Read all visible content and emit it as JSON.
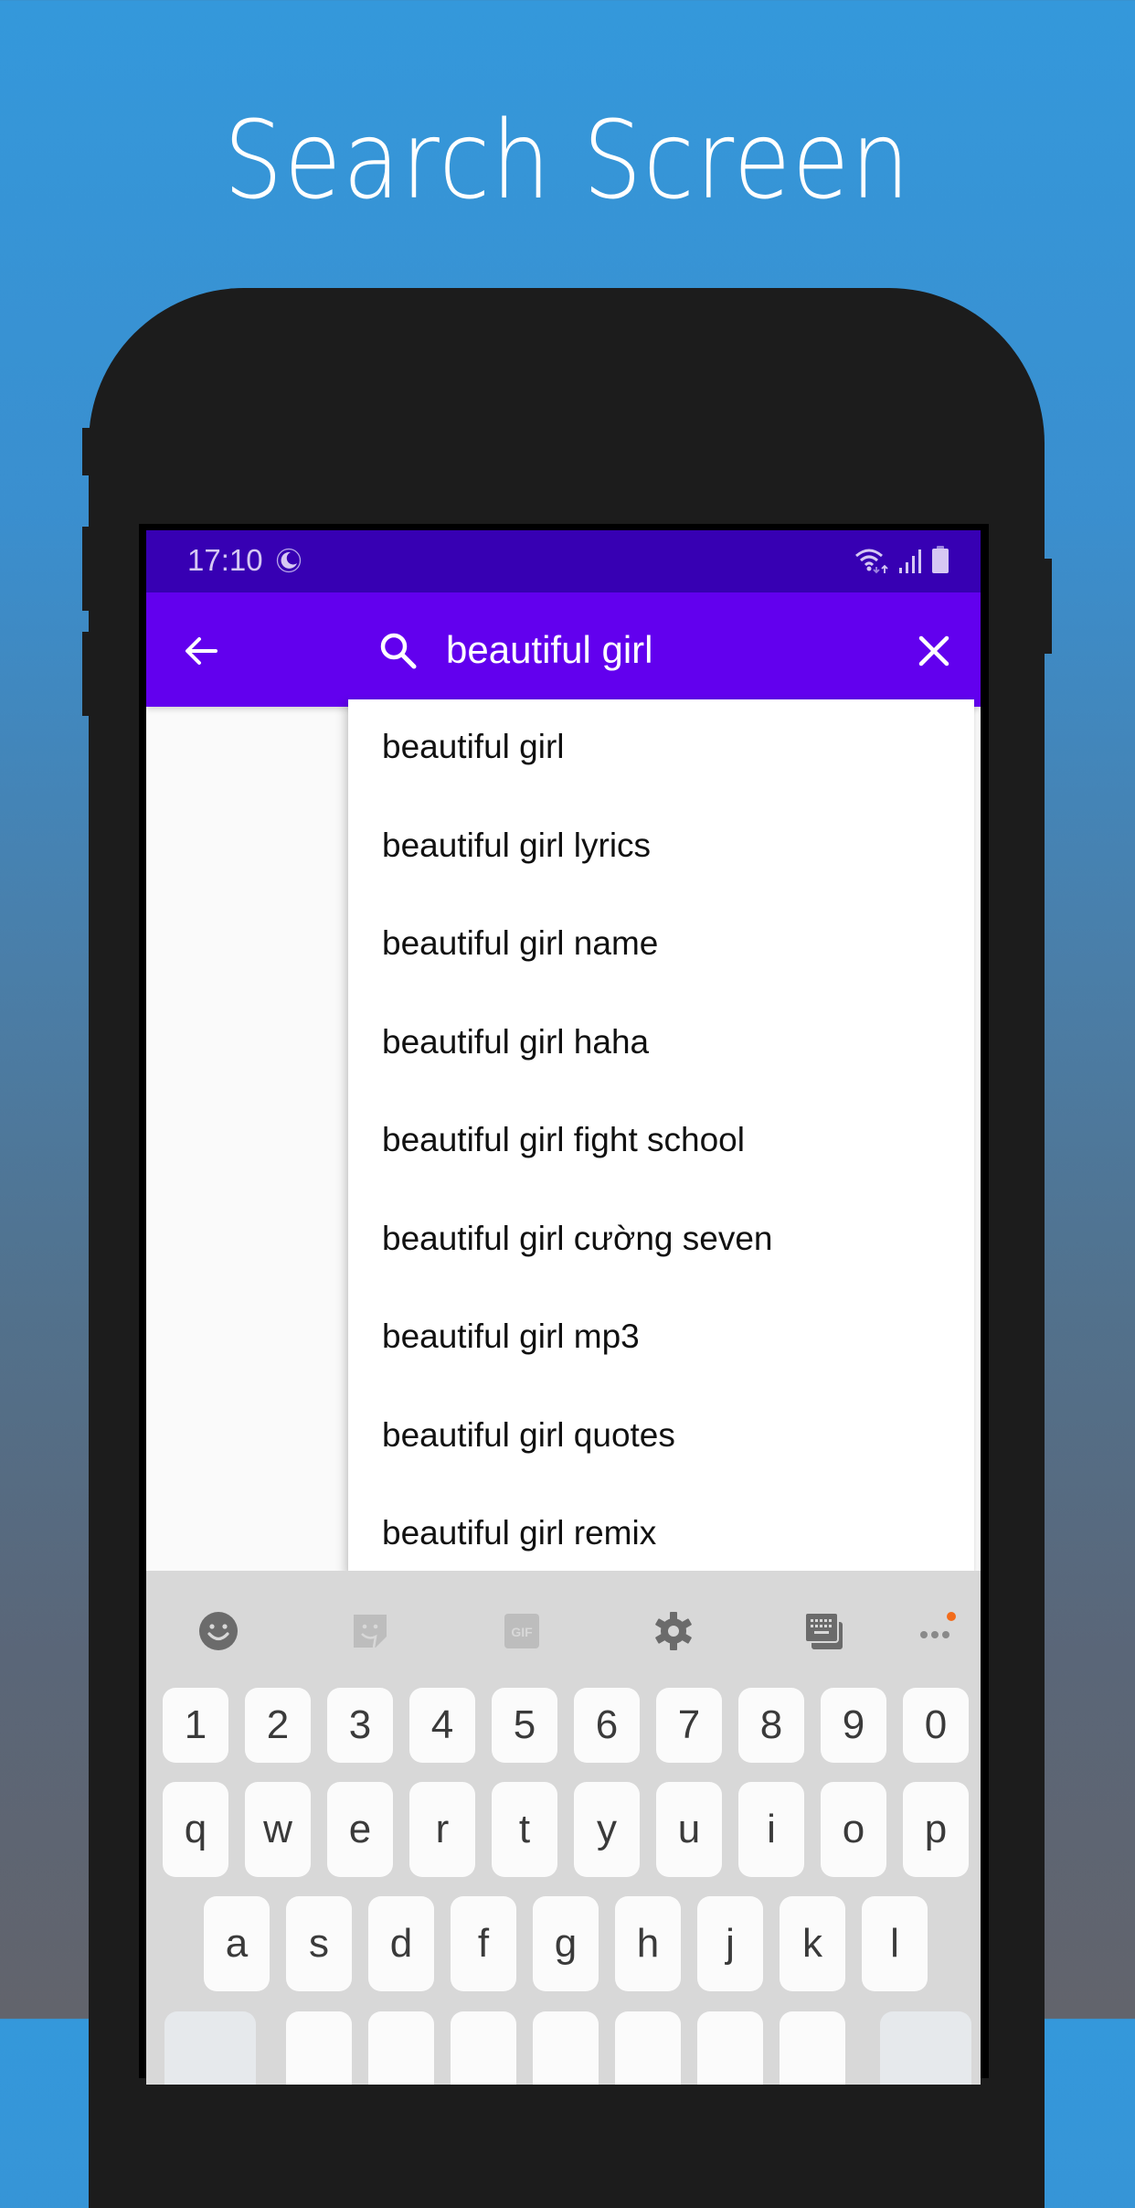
{
  "promo": {
    "title": "Search Screen",
    "background_top": "#3498db",
    "background_bottom": "#62646c"
  },
  "status_bar": {
    "time": "17:10",
    "icons": [
      "moon-icon",
      "wifi-icon",
      "signal-icon",
      "battery-icon"
    ],
    "color": "#3700b3"
  },
  "app_bar": {
    "color": "#6200ee",
    "back_icon": "arrow-left-icon",
    "search_icon": "magnifier-icon",
    "search_value": "beautiful girl",
    "search_placeholder": "",
    "clear_icon": "close-icon"
  },
  "suggestions": [
    "beautiful girl",
    "beautiful girl lyrics",
    "beautiful girl name",
    "beautiful girl haha",
    "beautiful girl fight school",
    "beautiful girl cường seven",
    "beautiful girl mp3",
    "beautiful girl quotes",
    "beautiful girl remix"
  ],
  "keyboard": {
    "toolbar": [
      {
        "name": "emoji-icon",
        "enabled": true
      },
      {
        "name": "sticker-icon",
        "enabled": false
      },
      {
        "name": "gif-icon",
        "label": "GIF",
        "enabled": false
      },
      {
        "name": "gear-icon",
        "enabled": true
      },
      {
        "name": "keyboard-switch-icon",
        "enabled": true
      },
      {
        "name": "more-icon",
        "enabled": true,
        "badge_color": "#f26c1b"
      }
    ],
    "rows": {
      "numbers": [
        "1",
        "2",
        "3",
        "4",
        "5",
        "6",
        "7",
        "8",
        "9",
        "0"
      ],
      "top": [
        "q",
        "w",
        "e",
        "r",
        "t",
        "y",
        "u",
        "i",
        "o",
        "p"
      ],
      "middle": [
        "a",
        "s",
        "d",
        "f",
        "g",
        "h",
        "j",
        "k",
        "l"
      ]
    }
  }
}
